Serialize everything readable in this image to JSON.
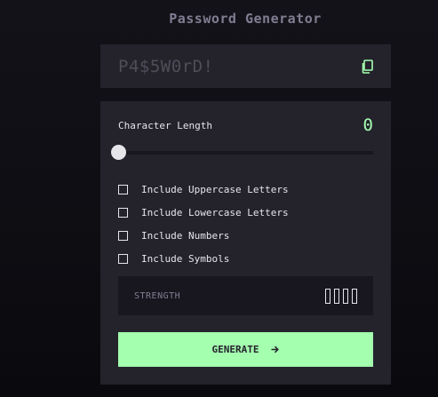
{
  "app": {
    "title": "Password Generator"
  },
  "output": {
    "password": "P4$5W0rD!",
    "copy_icon": "copy-icon"
  },
  "settings": {
    "length_label": "Character Length",
    "length_value": "0",
    "slider_fraction": 0
  },
  "options": [
    {
      "label": "Include Uppercase Letters",
      "checked": false
    },
    {
      "label": "Include Lowercase Letters",
      "checked": false
    },
    {
      "label": "Include Numbers",
      "checked": false
    },
    {
      "label": "Include Symbols",
      "checked": false
    }
  ],
  "strength": {
    "label": "STRENGTH",
    "bars_filled": 0,
    "bars_total": 4
  },
  "actions": {
    "generate_label": "GENERATE",
    "arrow_icon": "arrow-right-icon"
  },
  "colors": {
    "accent": "#a4ffaf",
    "panel": "#24232c",
    "dark": "#18171f",
    "muted": "#817d92",
    "text": "#e6e5ea"
  }
}
